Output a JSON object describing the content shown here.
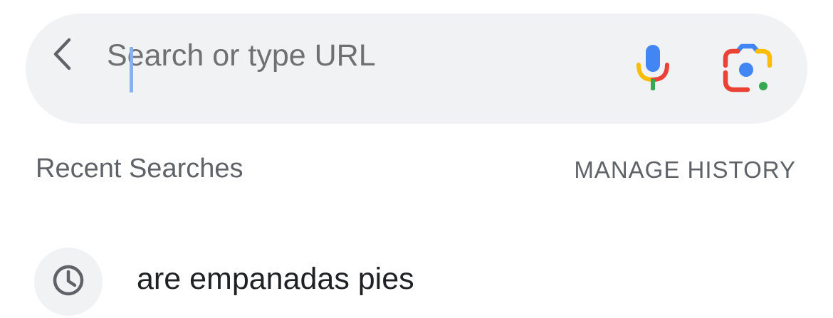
{
  "search": {
    "placeholder": "Search or type URL",
    "value": ""
  },
  "icons": {
    "back": "chevron-left-icon",
    "mic": "microphone-icon",
    "lens": "google-lens-icon",
    "history": "clock-icon"
  },
  "colors": {
    "search_bg": "#f1f2f4",
    "caret": "#8ab0f0",
    "google_blue": "#4285f4",
    "google_red": "#ea4335",
    "google_yellow": "#fbbc04",
    "google_green": "#34a853"
  },
  "recent": {
    "title": "Recent Searches",
    "manage_label": "MANAGE HISTORY",
    "items": [
      {
        "text": "are empanadas pies"
      }
    ]
  }
}
